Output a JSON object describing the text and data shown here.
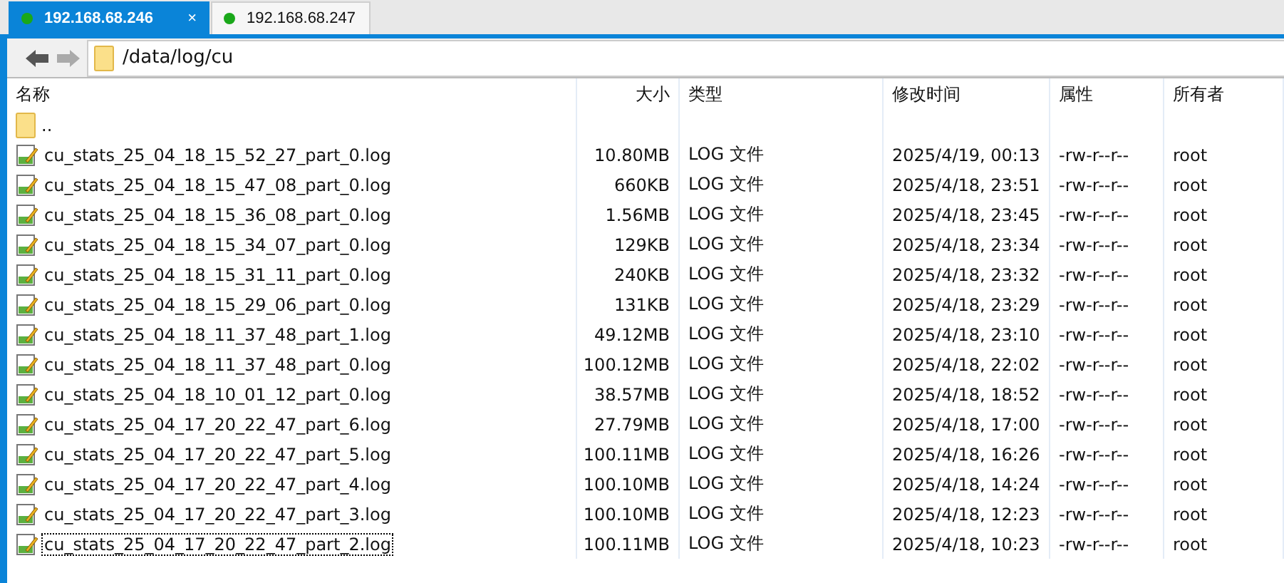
{
  "tabs": [
    {
      "label": "192.168.68.246",
      "selected": true,
      "color": "#1aa81a",
      "close": "×"
    },
    {
      "label": "192.168.68.247",
      "selected": false,
      "color": "#1aa81a"
    }
  ],
  "path": "/data/log/cu",
  "table": {
    "columns": [
      "名称",
      "大小",
      "类型",
      "修改时间",
      "属性",
      "所有者"
    ],
    "parent": "..",
    "rows": [
      {
        "name": "cu_stats_25_04_18_15_52_27_part_0.log",
        "size": "10.80MB",
        "type": "LOG 文件",
        "modified": "2025/4/19, 00:13",
        "attributes": "-rw-r--r--",
        "owner": "root",
        "focused": false
      },
      {
        "name": "cu_stats_25_04_18_15_47_08_part_0.log",
        "size": "660KB",
        "type": "LOG 文件",
        "modified": "2025/4/18, 23:51",
        "attributes": "-rw-r--r--",
        "owner": "root",
        "focused": false
      },
      {
        "name": "cu_stats_25_04_18_15_36_08_part_0.log",
        "size": "1.56MB",
        "type": "LOG 文件",
        "modified": "2025/4/18, 23:45",
        "attributes": "-rw-r--r--",
        "owner": "root",
        "focused": false
      },
      {
        "name": "cu_stats_25_04_18_15_34_07_part_0.log",
        "size": "129KB",
        "type": "LOG 文件",
        "modified": "2025/4/18, 23:34",
        "attributes": "-rw-r--r--",
        "owner": "root",
        "focused": false
      },
      {
        "name": "cu_stats_25_04_18_15_31_11_part_0.log",
        "size": "240KB",
        "type": "LOG 文件",
        "modified": "2025/4/18, 23:32",
        "attributes": "-rw-r--r--",
        "owner": "root",
        "focused": false
      },
      {
        "name": "cu_stats_25_04_18_15_29_06_part_0.log",
        "size": "131KB",
        "type": "LOG 文件",
        "modified": "2025/4/18, 23:29",
        "attributes": "-rw-r--r--",
        "owner": "root",
        "focused": false
      },
      {
        "name": "cu_stats_25_04_18_11_37_48_part_1.log",
        "size": "49.12MB",
        "type": "LOG 文件",
        "modified": "2025/4/18, 23:10",
        "attributes": "-rw-r--r--",
        "owner": "root",
        "focused": false
      },
      {
        "name": "cu_stats_25_04_18_11_37_48_part_0.log",
        "size": "100.12MB",
        "type": "LOG 文件",
        "modified": "2025/4/18, 22:02",
        "attributes": "-rw-r--r--",
        "owner": "root",
        "focused": false
      },
      {
        "name": "cu_stats_25_04_18_10_01_12_part_0.log",
        "size": "38.57MB",
        "type": "LOG 文件",
        "modified": "2025/4/18, 18:52",
        "attributes": "-rw-r--r--",
        "owner": "root",
        "focused": false
      },
      {
        "name": "cu_stats_25_04_17_20_22_47_part_6.log",
        "size": "27.79MB",
        "type": "LOG 文件",
        "modified": "2025/4/18, 17:00",
        "attributes": "-rw-r--r--",
        "owner": "root",
        "focused": false
      },
      {
        "name": "cu_stats_25_04_17_20_22_47_part_5.log",
        "size": "100.11MB",
        "type": "LOG 文件",
        "modified": "2025/4/18, 16:26",
        "attributes": "-rw-r--r--",
        "owner": "root",
        "focused": false
      },
      {
        "name": "cu_stats_25_04_17_20_22_47_part_4.log",
        "size": "100.10MB",
        "type": "LOG 文件",
        "modified": "2025/4/18, 14:24",
        "attributes": "-rw-r--r--",
        "owner": "root",
        "focused": false
      },
      {
        "name": "cu_stats_25_04_17_20_22_47_part_3.log",
        "size": "100.10MB",
        "type": "LOG 文件",
        "modified": "2025/4/18, 12:23",
        "attributes": "-rw-r--r--",
        "owner": "root",
        "focused": false
      },
      {
        "name": "cu_stats_25_04_17_20_22_47_part_2.log",
        "size": "100.11MB",
        "type": "LOG 文件",
        "modified": "2025/4/18, 10:23",
        "attributes": "-rw-r--r--",
        "owner": "root",
        "focused": true
      }
    ]
  }
}
